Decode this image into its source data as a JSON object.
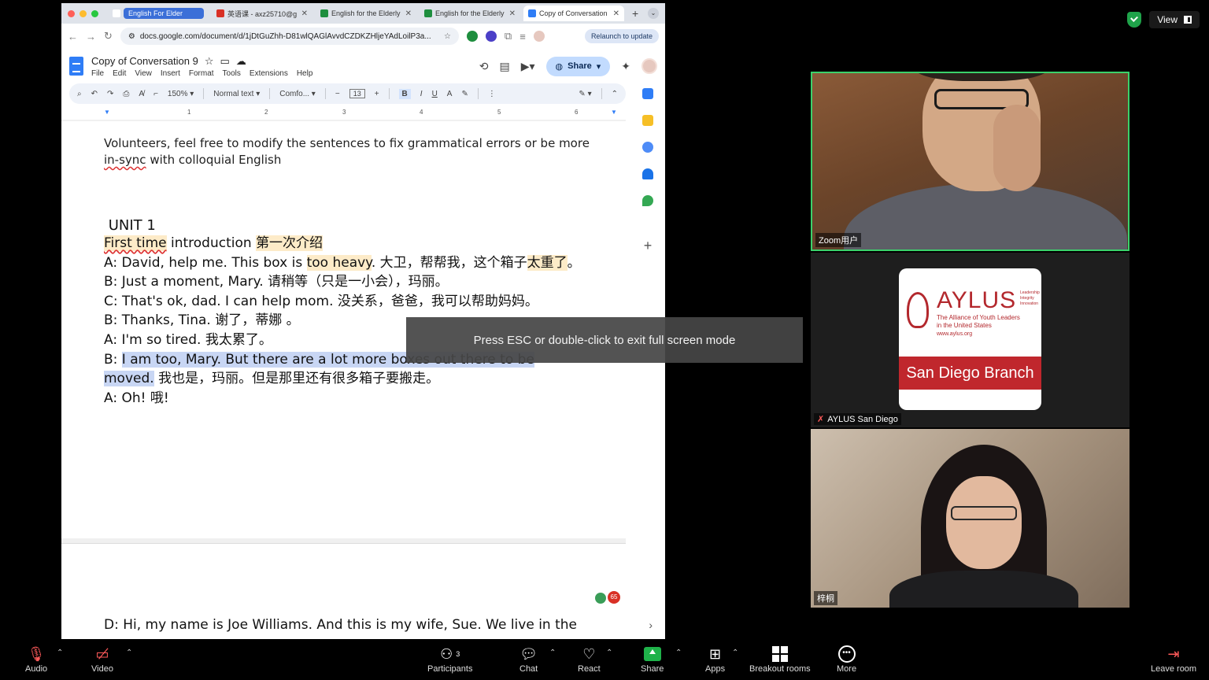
{
  "zoom_top": {
    "view_label": "View"
  },
  "browser": {
    "tabs": [
      {
        "title": "English For Elder",
        "color": "#3b6fd8",
        "pill": true
      },
      {
        "title": "英语课 - axz25710@g",
        "color": "#d93025"
      },
      {
        "title": "English for the Elderly",
        "color": "#1e8e3e"
      },
      {
        "title": "English for the Elderly",
        "color": "#1e8e3e"
      },
      {
        "title": "Copy of Conversation",
        "color": "#2f7df6",
        "active": true
      }
    ],
    "url": "docs.google.com/document/d/1jDtGuZhh-D81wlQAGlAvvdCZDKZHljeYAdLoilP3a...",
    "relaunch": "Relaunch to update"
  },
  "doc": {
    "title": "Copy of Conversation 9",
    "menu": [
      "File",
      "Edit",
      "View",
      "Insert",
      "Format",
      "Tools",
      "Extensions",
      "Help"
    ],
    "share": "Share",
    "toolbar": {
      "zoom": "150%",
      "style": "Normal text",
      "font": "Comfo...",
      "size": "13"
    },
    "ruler": [
      "1",
      "2",
      "3",
      "4",
      "5",
      "6"
    ],
    "intro_line1": "Volunteers, feel free to modify the sentences to fix grammatical errors or be more",
    "intro_word": "in-sync",
    "intro_rest": " with colloquial English",
    "unit": "UNIT 1",
    "heading_hl": "First time",
    "heading_rest": " introduction   ",
    "heading_cn": "第一次介绍",
    "lines": {
      "a1_pre": "A: David, help me. This box is ",
      "a1_hl": "too heavy",
      "a1_mid": ". 大卫，帮帮我，这个箱子",
      "a1_hl2": "太重了",
      "a1_end": "。",
      "b1": "B: Just a moment, Mary. 请稍等（只是一小会），玛丽。",
      "c1": "C: That's ok, dad. I can help mom. 没关系，爸爸，我可以帮助妈妈。",
      "b2": "B: Thanks, Tina. 谢了，蒂娜 。",
      "a2": "A: I'm so tired. 我太累了。",
      "b3_pre": "B: ",
      "b3_hl": "I am too, Mary. But there are a lot more boxes out there to be",
      "b3_hl2": "moved.",
      "b3_cn": " 我也是，玛丽。但是那里还有很多箱子要搬走。",
      "a3": "A: Oh! 哦!"
    },
    "next_line": "D: Hi, my name is Joe Williams. And this is my wife, Sue. We live in the",
    "collab_count": "65"
  },
  "fullscreen_toast": "Press ESC or double-click to exit full screen mode",
  "tiles": {
    "t1_label": "Zoom用户",
    "t2_label": "AYLUS San Diego",
    "t3_label": "梓桐",
    "aylus": {
      "name": "AYLUS",
      "motto1": "Leadership",
      "motto2": "Integrity",
      "motto3": "Innovation",
      "full1": "The Alliance of Youth Leaders",
      "full2": "in the United States",
      "url": "www.aylus.org",
      "branch": "San Diego Branch"
    }
  },
  "bottombar": {
    "audio": "Audio",
    "video": "Video",
    "participants": "Participants",
    "participants_count": "3",
    "chat": "Chat",
    "react": "React",
    "share": "Share",
    "apps": "Apps",
    "breakout": "Breakout rooms",
    "more": "More",
    "leave": "Leave room"
  }
}
